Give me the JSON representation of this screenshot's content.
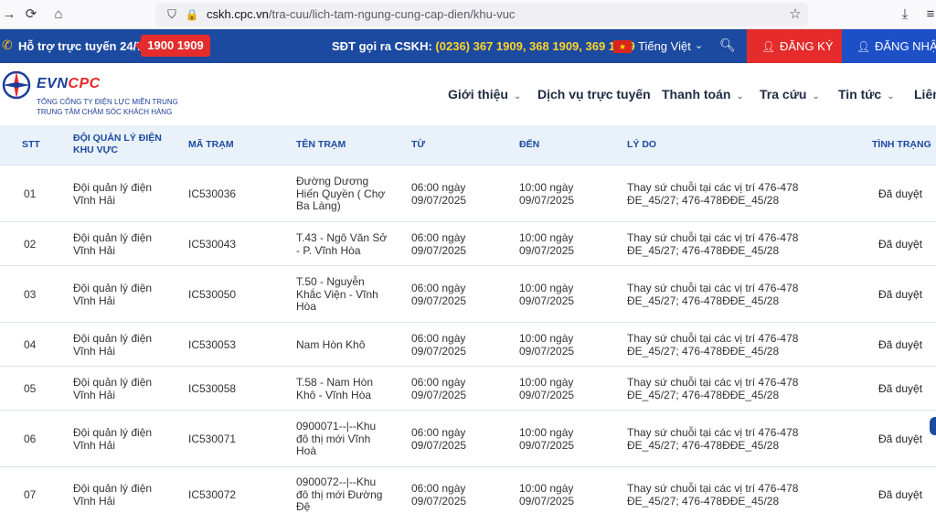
{
  "browser": {
    "url_domain": "cskh.cpc.vn",
    "url_path": "/tra-cuu/lich-tam-ngung-cung-cap-dien/khu-vuc"
  },
  "topbar": {
    "support_label": "Hỗ trợ trực tuyến 24/7:",
    "hotline": "1900 1909",
    "cskh_label": "SĐT gọi ra CSKH:",
    "cskh_numbers": "(0236) 367 1909, 368 1909, 369 1909",
    "language": "Tiếng Việt",
    "register_label": "ĐĂNG KÝ",
    "login_label": "ĐĂNG NHẬP"
  },
  "logo": {
    "evn": "EVN",
    "cpc": "CPC",
    "line1": "TỔNG CÔNG TY ĐIỆN LỰC MIỀN TRUNG",
    "line2": "TRUNG TÂM CHĂM SÓC KHÁCH HÀNG"
  },
  "nav": {
    "items": [
      {
        "label": "Giới thiệu"
      },
      {
        "label": "Dịch vụ trực tuyến"
      },
      {
        "label": "Thanh toán"
      },
      {
        "label": "Tra cứu"
      },
      {
        "label": "Tin tức"
      },
      {
        "label": "Liên"
      }
    ]
  },
  "table": {
    "headers": {
      "stt": "STT",
      "doi": "ĐỘI QUẢN LÝ ĐIỆN KHU VỰC",
      "ma_tram": "MÃ TRẠM",
      "ten_tram": "TÊN TRẠM",
      "tu": "TỪ",
      "den": "ĐẾN",
      "ly_do": "LÝ DO",
      "tinh_trang": "TÌNH TRẠNG"
    },
    "rows": [
      {
        "stt": "01",
        "doi": "Đội quản lý điện Vĩnh Hải",
        "ma": "IC530036",
        "ten": "Đường Dương Hiến Quyền ( Chợ Ba Làng)",
        "tu": "06:00 ngày 09/07/2025",
        "den": "10:00 ngày 09/07/2025",
        "lydo": "Thay sứ chuỗi tại các vị trí 476-478 ĐE_45/27; 476-478ĐĐE_45/28",
        "tt": "Đã duyệt"
      },
      {
        "stt": "02",
        "doi": "Đội quản lý điện Vĩnh Hải",
        "ma": "IC530043",
        "ten": "T.43 - Ngô Văn Sở - P. Vĩnh Hòa",
        "tu": "06:00 ngày 09/07/2025",
        "den": "10:00 ngày 09/07/2025",
        "lydo": "Thay sứ chuỗi tại các vị trí 476-478 ĐE_45/27; 476-478ĐĐE_45/28",
        "tt": "Đã duyệt"
      },
      {
        "stt": "03",
        "doi": "Đội quản lý điện Vĩnh Hải",
        "ma": "IC530050",
        "ten": "T.50 - Nguyễn Khắc Viện - Vĩnh Hòa",
        "tu": "06:00 ngày 09/07/2025",
        "den": "10:00 ngày 09/07/2025",
        "lydo": "Thay sứ chuỗi tại các vị trí 476-478 ĐE_45/27; 476-478ĐĐE_45/28",
        "tt": "Đã duyệt"
      },
      {
        "stt": "04",
        "doi": "Đội quản lý điện Vĩnh Hải",
        "ma": "IC530053",
        "ten": "Nam Hòn Khô",
        "tu": "06:00 ngày 09/07/2025",
        "den": "10:00 ngày 09/07/2025",
        "lydo": "Thay sứ chuỗi tại các vị trí 476-478 ĐE_45/27; 476-478ĐĐE_45/28",
        "tt": "Đã duyệt"
      },
      {
        "stt": "05",
        "doi": "Đội quản lý điện Vĩnh Hải",
        "ma": "IC530058",
        "ten": "T.58 - Nam Hòn Khô - Vĩnh Hòa",
        "tu": "06:00 ngày 09/07/2025",
        "den": "10:00 ngày 09/07/2025",
        "lydo": "Thay sứ chuỗi tại các vị trí 476-478 ĐE_45/27; 476-478ĐĐE_45/28",
        "tt": "Đã duyệt"
      },
      {
        "stt": "06",
        "doi": "Đội quản lý điện Vĩnh Hải",
        "ma": "IC530071",
        "ten": "0900071--|--Khu đô thị mới Vĩnh Hoà",
        "tu": "06:00 ngày 09/07/2025",
        "den": "10:00 ngày 09/07/2025",
        "lydo": "Thay sứ chuỗi tại các vị trí 476-478 ĐE_45/27; 476-478ĐĐE_45/28",
        "tt": "Đã duyệt"
      },
      {
        "stt": "07",
        "doi": "Đội quản lý điện Vĩnh Hải",
        "ma": "IC530072",
        "ten": "0900072--|--Khu đô thị mới Đường Đệ",
        "tu": "06:00 ngày 09/07/2025",
        "den": "10:00 ngày 09/07/2025",
        "lydo": "Thay sứ chuỗi tại các vị trí 476-478 ĐE_45/27; 476-478ĐĐE_45/28",
        "tt": "Đã duyệt"
      }
    ]
  }
}
